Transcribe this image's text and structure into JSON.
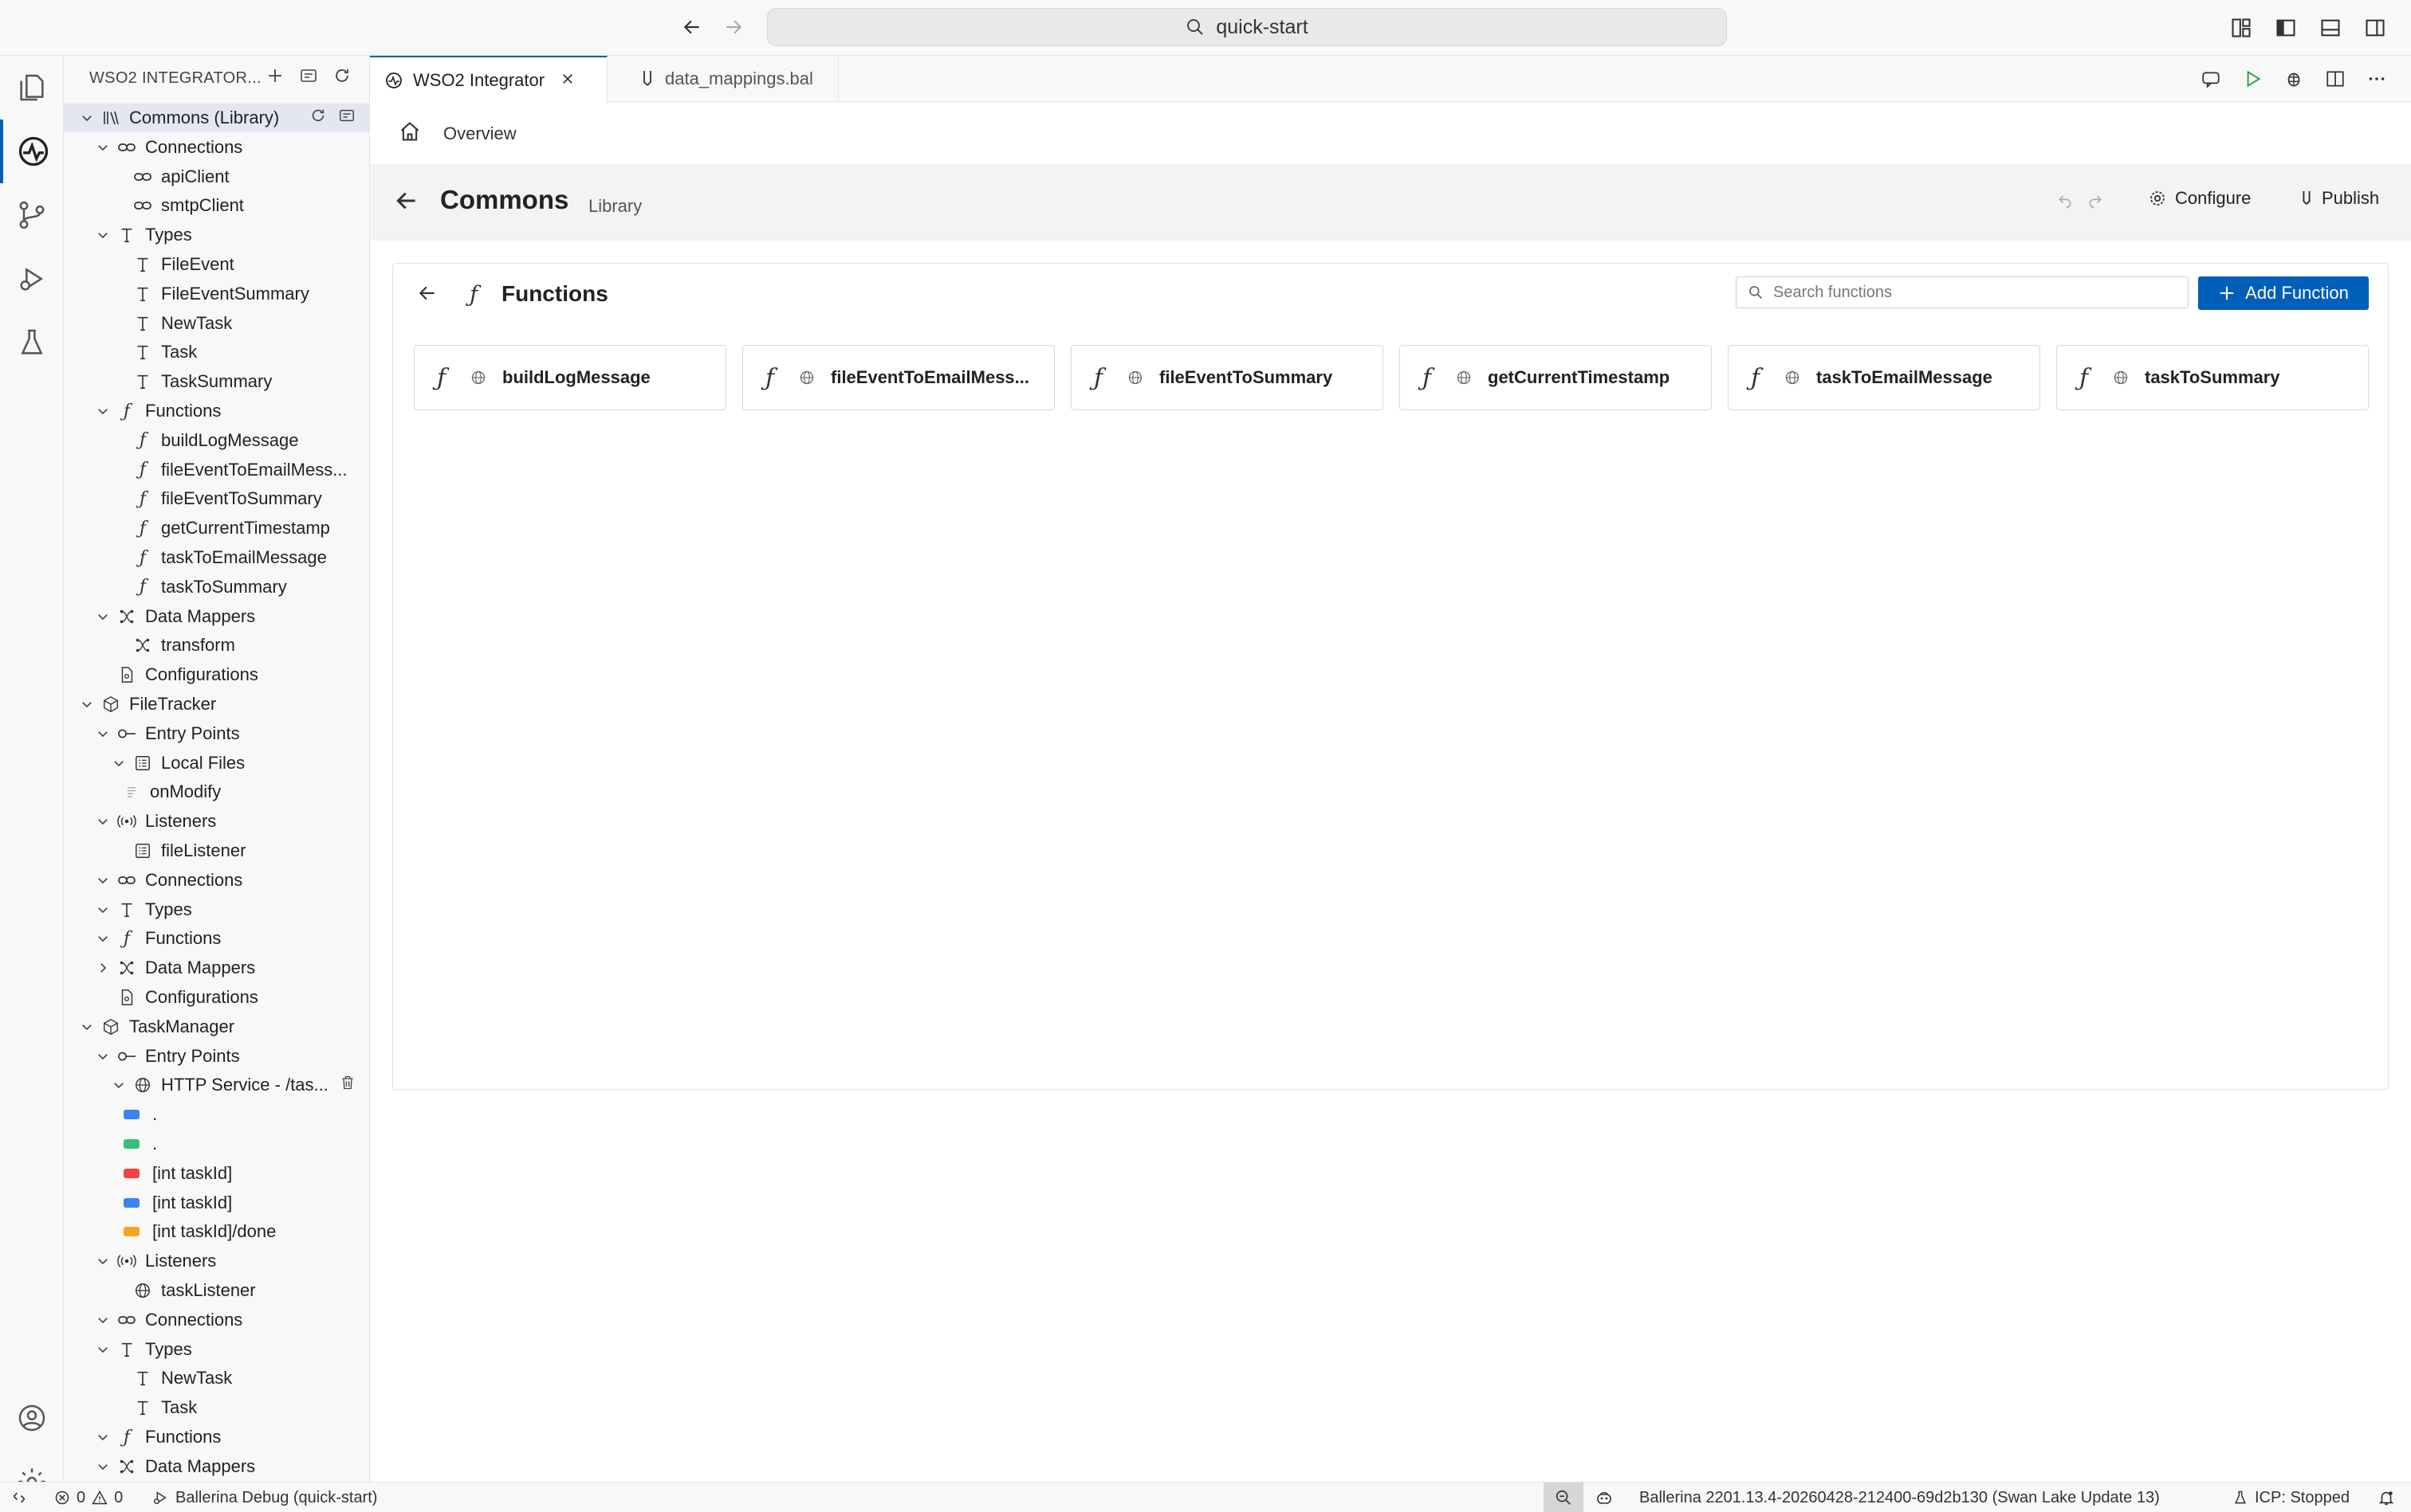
{
  "window": {
    "command_center": "quick-start"
  },
  "sidebar": {
    "header_title": "WSO2 INTEGRATOR...",
    "tree": [
      {
        "label": "Commons (Library)",
        "level": 0,
        "icon": "library-icon",
        "expanded": true,
        "selected": true
      },
      {
        "label": "Connections",
        "level": 1,
        "icon": "link-icon",
        "expanded": true
      },
      {
        "label": "apiClient",
        "level": 2,
        "icon": "link-icon"
      },
      {
        "label": "smtpClient",
        "level": 2,
        "icon": "link-icon"
      },
      {
        "label": "Types",
        "level": 1,
        "icon": "type-icon",
        "expanded": true
      },
      {
        "label": "FileEvent",
        "level": 2,
        "icon": "type-icon"
      },
      {
        "label": "FileEventSummary",
        "level": 2,
        "icon": "type-icon"
      },
      {
        "label": "NewTask",
        "level": 2,
        "icon": "type-icon"
      },
      {
        "label": "Task",
        "level": 2,
        "icon": "type-icon"
      },
      {
        "label": "TaskSummary",
        "level": 2,
        "icon": "type-icon"
      },
      {
        "label": "Functions",
        "level": 1,
        "icon": "function-icon",
        "expanded": true
      },
      {
        "label": "buildLogMessage",
        "level": 2,
        "icon": "function-icon"
      },
      {
        "label": "fileEventToEmailMess...",
        "level": 2,
        "icon": "function-icon"
      },
      {
        "label": "fileEventToSummary",
        "level": 2,
        "icon": "function-icon"
      },
      {
        "label": "getCurrentTimestamp",
        "level": 2,
        "icon": "function-icon"
      },
      {
        "label": "taskToEmailMessage",
        "level": 2,
        "icon": "function-icon"
      },
      {
        "label": "taskToSummary",
        "level": 2,
        "icon": "function-icon"
      },
      {
        "label": "Data Mappers",
        "level": 1,
        "icon": "data-mapper-icon",
        "expanded": true
      },
      {
        "label": "transform",
        "level": 2,
        "icon": "data-mapper-icon"
      },
      {
        "label": "Configurations",
        "level": 1,
        "icon": "config-file-icon",
        "nochev": true
      },
      {
        "label": "FileTracker",
        "level": 0,
        "icon": "package-icon",
        "expanded": true
      },
      {
        "label": "Entry Points",
        "level": 1,
        "icon": "entry-point-icon",
        "expanded": true
      },
      {
        "label": "Local Files",
        "level": 2,
        "icon": "local-files-icon",
        "expanded": true,
        "chev": true
      },
      {
        "label": "onModify",
        "level": 3,
        "icon": "file-lines-icon"
      },
      {
        "label": "Listeners",
        "level": 1,
        "icon": "listener-icon",
        "expanded": true
      },
      {
        "label": "fileListener",
        "level": 2,
        "icon": "local-files-icon"
      },
      {
        "label": "Connections",
        "level": 1,
        "icon": "link-icon",
        "expanded": true
      },
      {
        "label": "Types",
        "level": 1,
        "icon": "type-icon",
        "expanded": true
      },
      {
        "label": "Functions",
        "level": 1,
        "icon": "function-icon",
        "expanded": true
      },
      {
        "label": "Data Mappers",
        "level": 1,
        "icon": "data-mapper-icon",
        "expanded": false
      },
      {
        "label": "Configurations",
        "level": 1,
        "icon": "config-file-icon",
        "nochev": true
      },
      {
        "label": "TaskManager",
        "level": 0,
        "icon": "package-icon",
        "expanded": true
      },
      {
        "label": "Entry Points",
        "level": 1,
        "icon": "entry-point-icon",
        "expanded": true
      },
      {
        "label": "HTTP Service - /tas...",
        "level": 2,
        "icon": "globe-icon",
        "expanded": true,
        "chev": true,
        "trash": true
      },
      {
        "label": ".",
        "level": 3,
        "method_color": "#3b82f6"
      },
      {
        "label": ".",
        "level": 3,
        "method_color": "#34c27a"
      },
      {
        "label": "[int taskId]",
        "level": 3,
        "method_color": "#ef4444"
      },
      {
        "label": "[int taskId]",
        "level": 3,
        "method_color": "#3b82f6"
      },
      {
        "label": "[int taskId]/done",
        "level": 3,
        "method_color": "#f5a524"
      },
      {
        "label": "Listeners",
        "level": 1,
        "icon": "listener-icon",
        "expanded": true
      },
      {
        "label": "taskListener",
        "level": 2,
        "icon": "globe-icon"
      },
      {
        "label": "Connections",
        "level": 1,
        "icon": "link-icon",
        "expanded": true
      },
      {
        "label": "Types",
        "level": 1,
        "icon": "type-icon",
        "expanded": true
      },
      {
        "label": "NewTask",
        "level": 2,
        "icon": "type-icon"
      },
      {
        "label": "Task",
        "level": 2,
        "icon": "type-icon"
      },
      {
        "label": "Functions",
        "level": 1,
        "icon": "function-icon",
        "expanded": true
      },
      {
        "label": "Data Mappers",
        "level": 1,
        "icon": "data-mapper-icon",
        "expanded": true
      }
    ]
  },
  "tabs": [
    {
      "label": "WSO2 Integrator",
      "icon": "wso2-icon",
      "active": true
    },
    {
      "label": "data_mappings.bal",
      "icon": "ballerina-file-icon",
      "active": false
    }
  ],
  "breadcrumb": {
    "overview": "Overview"
  },
  "project": {
    "name": "Commons",
    "kind": "Library",
    "configure_label": "Configure",
    "publish_label": "Publish"
  },
  "functions_panel": {
    "title": "Functions",
    "search_placeholder": "Search functions",
    "add_label": "Add Function",
    "items": [
      "buildLogMessage",
      "fileEventToEmailMess...",
      "fileEventToSummary",
      "getCurrentTimestamp",
      "taskToEmailMessage",
      "taskToSummary"
    ]
  },
  "statusbar": {
    "errors": "0",
    "warnings": "0",
    "debug": "Ballerina Debug (quick-start)",
    "version": "Ballerina 2201.13.4-20260428-212400-69d2b130 (Swan Lake Update 13)",
    "icp": "ICP: Stopped"
  },
  "colors": {
    "accent": "#005fb8",
    "method_get": "#3b82f6",
    "method_post": "#34c27a",
    "method_delete": "#ef4444",
    "method_patch": "#f5a524"
  }
}
